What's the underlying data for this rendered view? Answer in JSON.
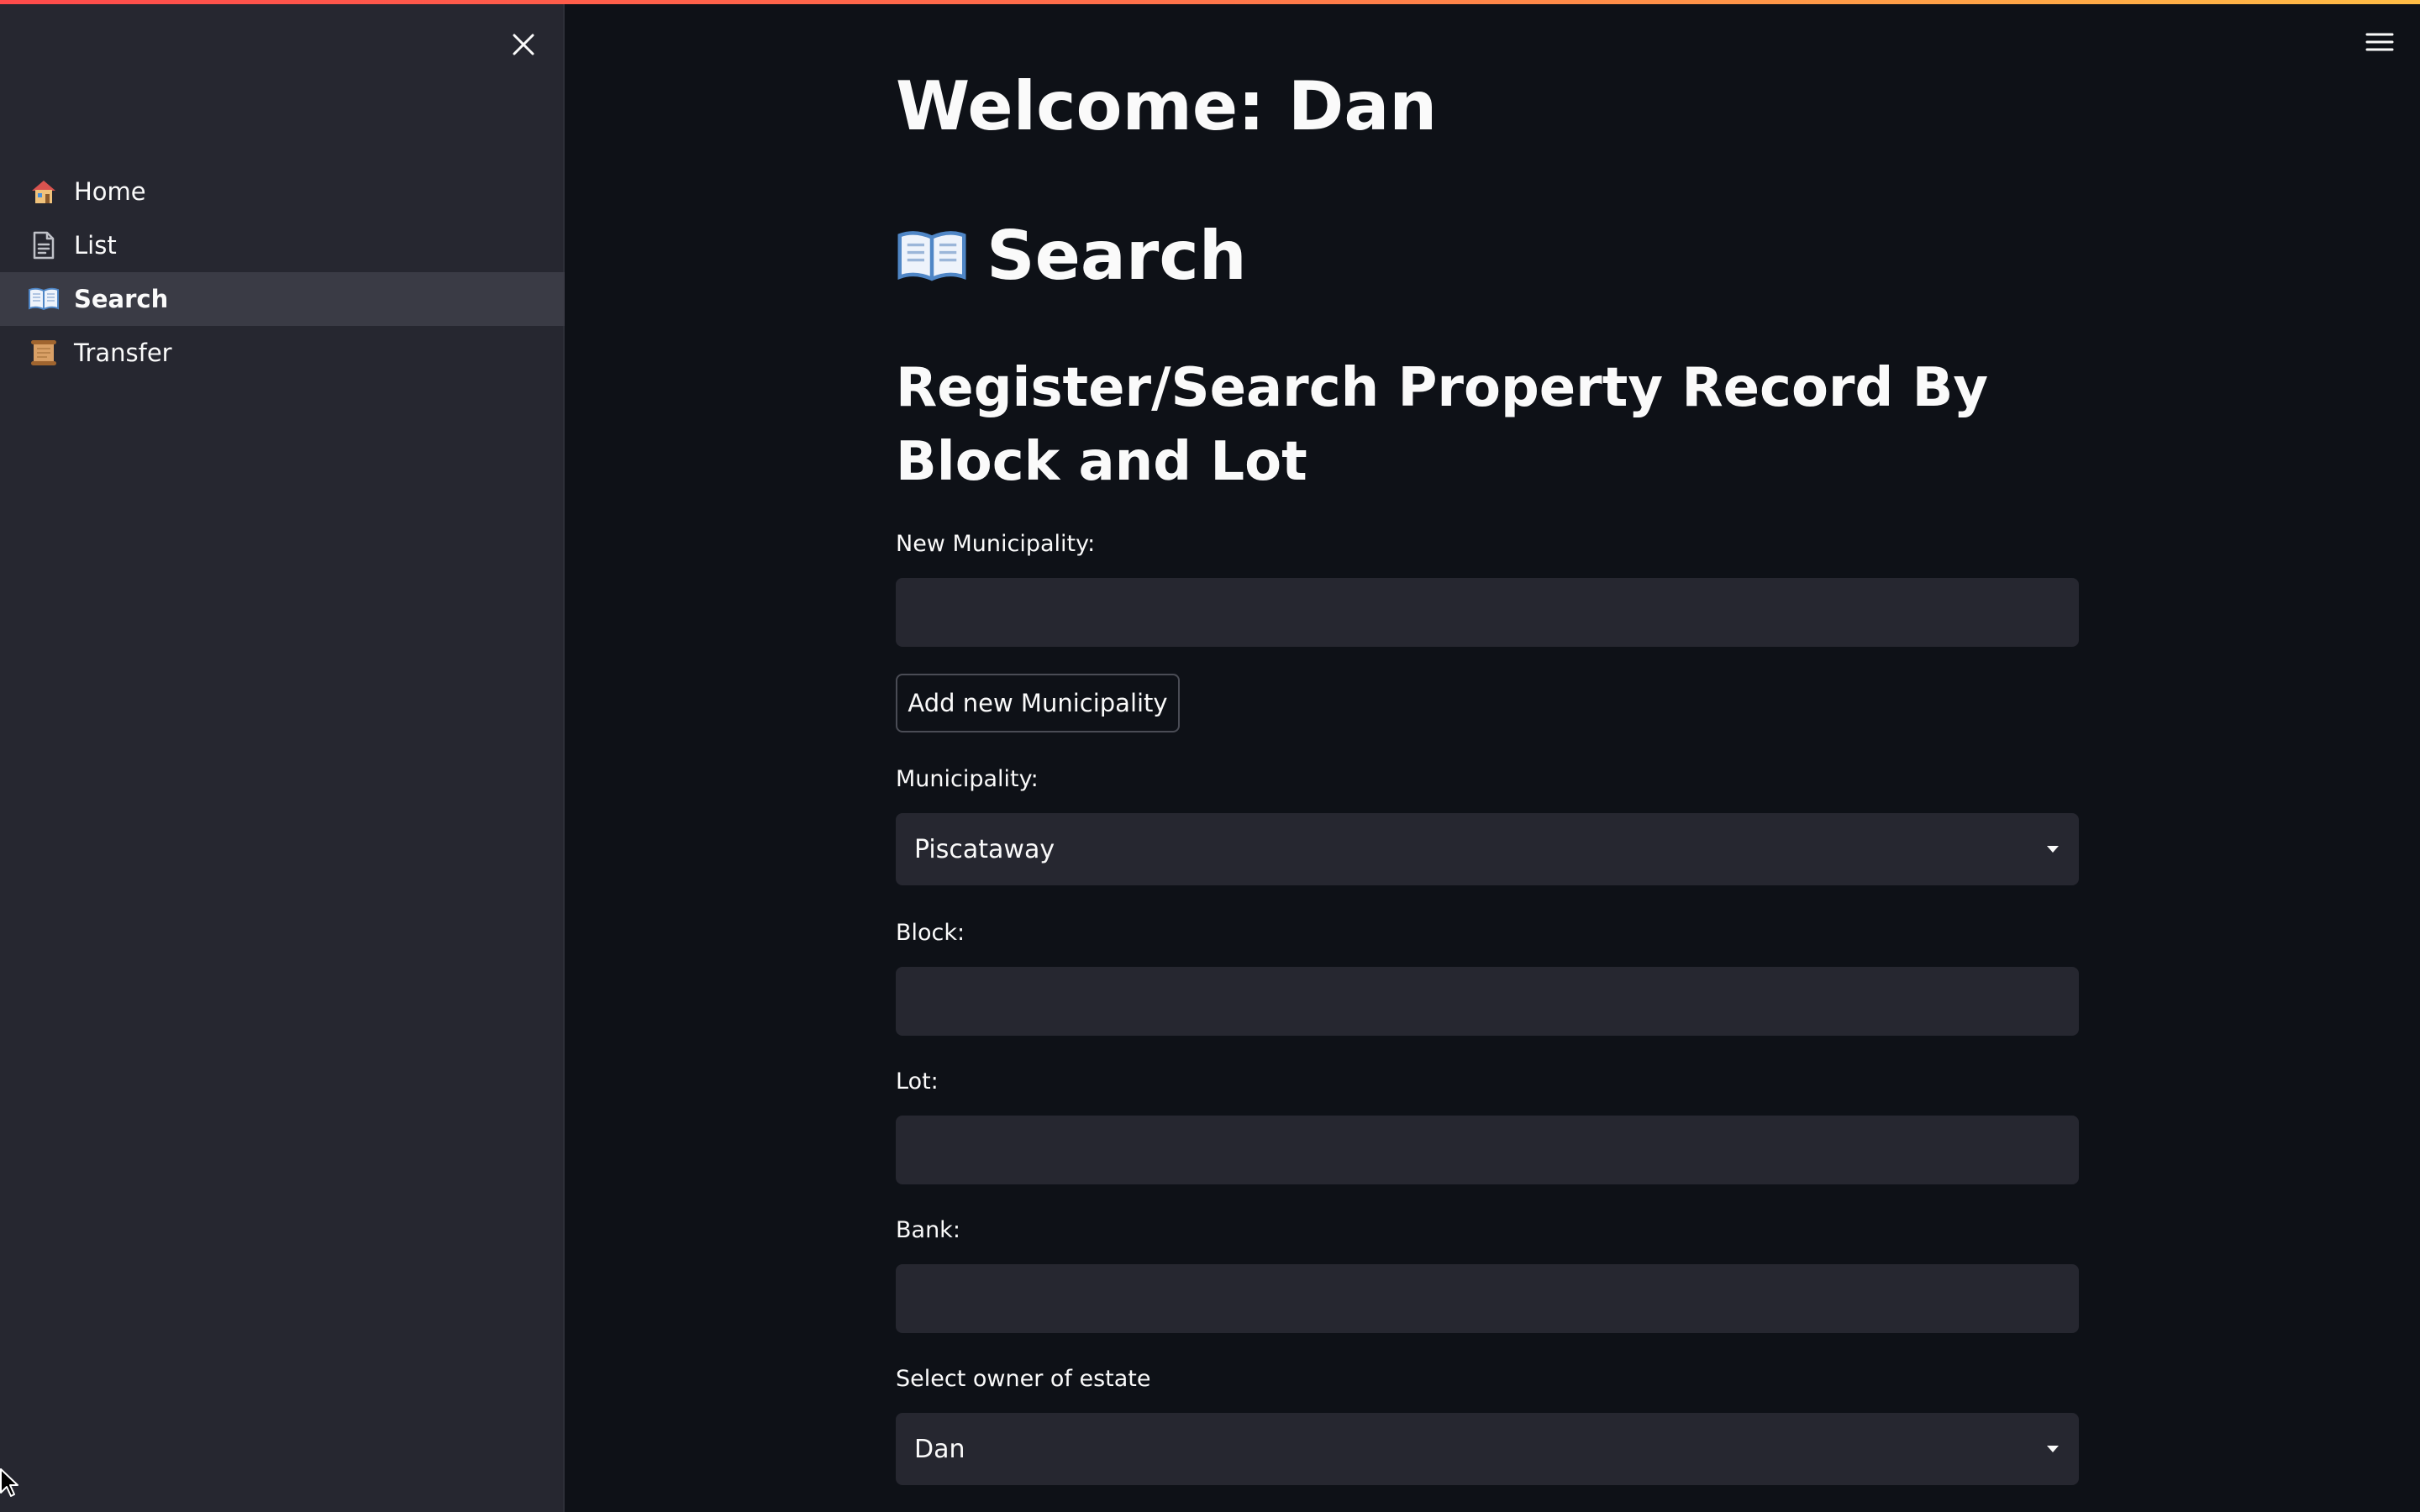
{
  "sidebar": {
    "items": [
      {
        "label": "Home",
        "icon": "house-icon",
        "active": false
      },
      {
        "label": "List",
        "icon": "document-icon",
        "active": false
      },
      {
        "label": "Search",
        "icon": "open-book-icon",
        "active": true
      },
      {
        "label": "Transfer",
        "icon": "scroll-icon",
        "active": false
      }
    ]
  },
  "main": {
    "welcome": "Welcome: Dan",
    "page_title": "Search",
    "section_title": "Register/Search Property Record By Block and Lot",
    "new_municipality": {
      "label": "New Municipality:",
      "value": ""
    },
    "add_button": "Add new Municipality",
    "municipality": {
      "label": "Municipality:",
      "selected": "Piscataway"
    },
    "block": {
      "label": "Block:",
      "value": ""
    },
    "lot": {
      "label": "Lot:",
      "value": ""
    },
    "bank": {
      "label": "Bank:",
      "value": ""
    },
    "owner": {
      "label": "Select owner of estate",
      "selected": "Dan"
    }
  },
  "colors": {
    "background": "#0e1117",
    "sidebar": "#262730",
    "input": "#262730",
    "accent_gradient_start": "#ff4b4b",
    "accent_gradient_end": "#ffbd45"
  }
}
